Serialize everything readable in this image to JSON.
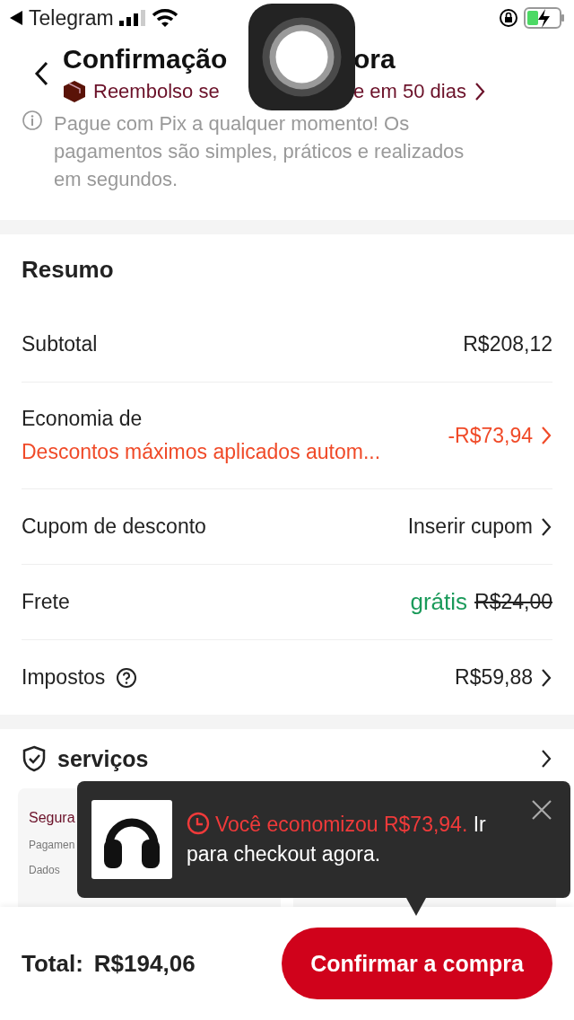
{
  "status_bar": {
    "app": "Telegram"
  },
  "header": {
    "title_parts": [
      "Confirmação",
      "ora"
    ],
    "refund_parts": [
      "Reembolso se",
      "e em 50 dias"
    ],
    "info": "Pague com Pix a qualquer momento! Os pagamentos são simples, práticos e realizados em segundos."
  },
  "summary": {
    "title": "Resumo",
    "rows": [
      {
        "kind": "plain",
        "label": "Subtotal",
        "value": "R$208,12",
        "chevron": false
      },
      {
        "kind": "discount",
        "label": "Economia de",
        "note": "Descontos máximos aplicados autom...",
        "value": "-R$73,94",
        "chevron": true
      },
      {
        "kind": "plain",
        "label": "Cupom de desconto",
        "value": "Inserir cupom",
        "chevron": true
      },
      {
        "kind": "shipping",
        "label": "Frete",
        "free_label": "grátis",
        "value": "R$24,00",
        "chevron": false
      },
      {
        "kind": "help",
        "label": "Impostos",
        "value": "R$59,88",
        "chevron": true
      }
    ]
  },
  "services": {
    "title": "serviços",
    "cards": [
      {
        "title": "Segura",
        "lines": [
          "Pagamen",
          "Dados"
        ]
      }
    ]
  },
  "toast": {
    "highlight": "Você economizou R$73,94.",
    "message": "Ir para checkout agora."
  },
  "bottom_bar": {
    "total_label": "Total:",
    "total_value": "R$194,06",
    "confirm": "Confirmar a compra"
  }
}
